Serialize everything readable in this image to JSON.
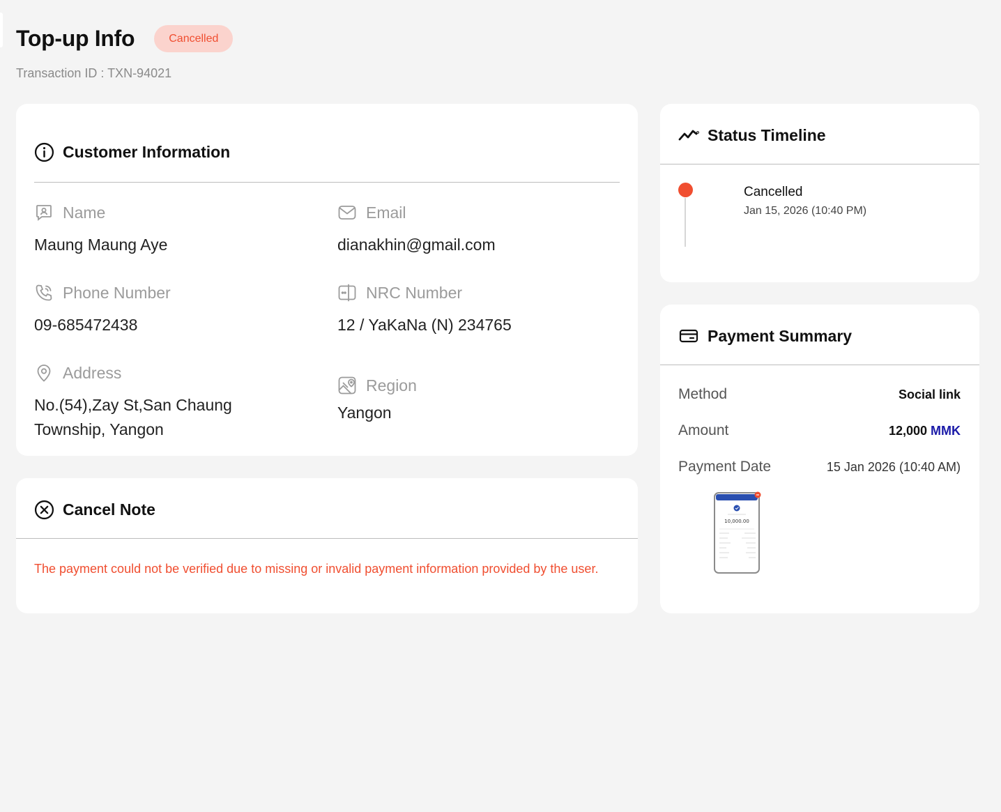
{
  "header": {
    "title": "Top-up Info",
    "status": "Cancelled",
    "transaction_label": "Transaction ID : ",
    "transaction_id": "TXN-94021"
  },
  "customer": {
    "title": "Customer Information",
    "fields": {
      "name": {
        "label": "Name",
        "value": "Maung Maung Aye",
        "icon": "contact-card-icon"
      },
      "email": {
        "label": "Email",
        "value": "dianakhin@gmail.com",
        "icon": "mail-icon"
      },
      "phone": {
        "label": "Phone Number",
        "value": "09-685472438",
        "icon": "phone-icon"
      },
      "nrc": {
        "label": "NRC Number",
        "value": "12 / YaKaNa (N) 234765",
        "icon": "id-card-icon"
      },
      "address": {
        "label": "Address",
        "line1": "No.(54),Zay St,San Chaung",
        "line2": "Township, Yangon",
        "icon": "location-pin-icon"
      },
      "region": {
        "label": "Region",
        "value": "Yangon",
        "icon": "map-icon"
      }
    }
  },
  "cancel_note": {
    "title": "Cancel Note",
    "text": "The payment could not be verified due to missing or invalid payment information provided by the user."
  },
  "timeline": {
    "title": "Status Timeline",
    "items": [
      {
        "status": "Cancelled",
        "date": "Jan 15, 2026 (10:40 PM)"
      }
    ]
  },
  "payment": {
    "title": "Payment Summary",
    "method_label": "Method",
    "method_value": "Social link",
    "amount_label": "Amount",
    "amount_value": "12,000",
    "amount_currency": "MMK",
    "date_label": "Payment Date",
    "date_value": "15 Jan 2026 (10:40 AM)",
    "receipt_amount": "10,000.00"
  },
  "colors": {
    "accent_red": "#f04e30",
    "pill_bg": "#fbd3cd",
    "currency_blue": "#1a1aa8",
    "page_bg": "#f4f4f4"
  }
}
